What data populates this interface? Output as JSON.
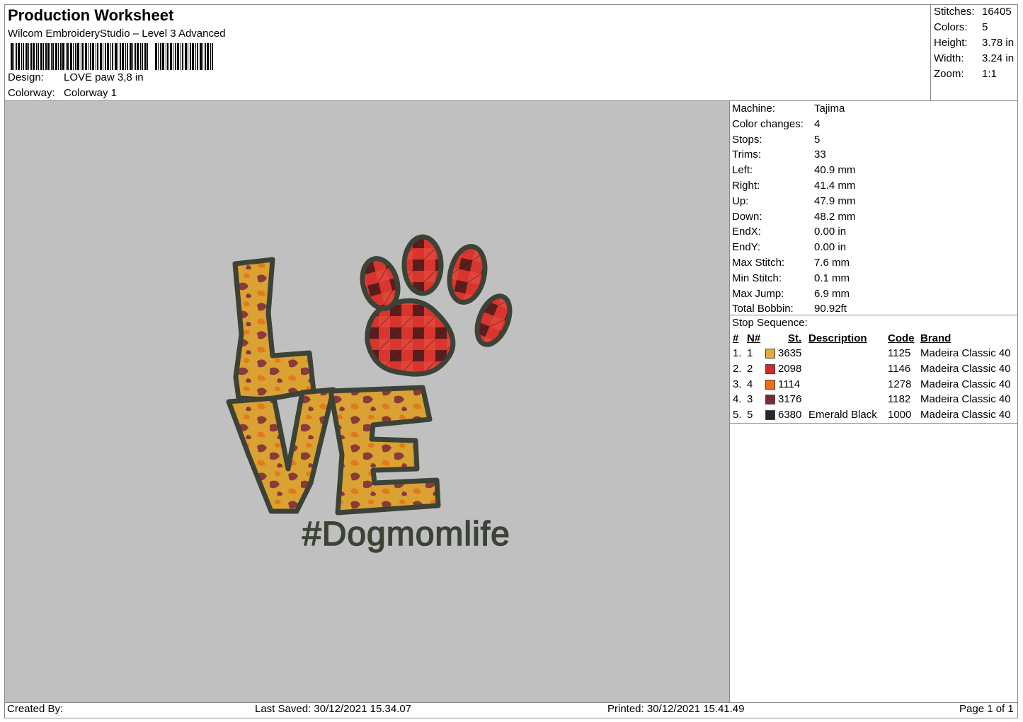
{
  "header": {
    "title": "Production Worksheet",
    "subtitle": "Wilcom EmbroideryStudio – Level 3 Advanced",
    "design_label": "Design:",
    "design_value": "LOVE paw 3,8 in",
    "colorway_label": "Colorway:",
    "colorway_value": "Colorway 1"
  },
  "stats": [
    {
      "label": "Stitches:",
      "value": "16405"
    },
    {
      "label": "Colors:",
      "value": "5"
    },
    {
      "label": "Height:",
      "value": "3.78 in"
    },
    {
      "label": "Width:",
      "value": "3.24 in"
    },
    {
      "label": "Zoom:",
      "value": "1:1"
    }
  ],
  "machine_info": [
    {
      "label": "Machine:",
      "value": "Tajima"
    },
    {
      "label": "Color changes:",
      "value": "4"
    },
    {
      "label": "Stops:",
      "value": "5"
    },
    {
      "label": "Trims:",
      "value": "33"
    },
    {
      "label": "Left:",
      "value": "40.9 mm"
    },
    {
      "label": "Right:",
      "value": "41.4 mm"
    },
    {
      "label": "Up:",
      "value": "47.9 mm"
    },
    {
      "label": "Down:",
      "value": "48.2 mm"
    },
    {
      "label": "EndX:",
      "value": "0.00 in"
    },
    {
      "label": "EndY:",
      "value": "0.00 in"
    },
    {
      "label": "Max Stitch:",
      "value": "7.6 mm"
    },
    {
      "label": "Min Stitch:",
      "value": "0.1 mm"
    },
    {
      "label": "Max Jump:",
      "value": "6.9 mm"
    },
    {
      "label": "Total Bobbin:",
      "value": "90.92ft"
    }
  ],
  "stop_sequence": {
    "title": "Stop Sequence:",
    "headers": {
      "num": "#",
      "n": "N#",
      "st": "St.",
      "description": "Description",
      "code": "Code",
      "brand": "Brand"
    },
    "rows": [
      {
        "num": "1.",
        "n": "1",
        "color": "#e8a83a",
        "st": "3635",
        "description": "",
        "code": "1125",
        "brand": "Madeira Classic 40"
      },
      {
        "num": "2.",
        "n": "2",
        "color": "#d8262b",
        "st": "2098",
        "description": "",
        "code": "1146",
        "brand": "Madeira Classic 40"
      },
      {
        "num": "3.",
        "n": "4",
        "color": "#f26a1b",
        "st": "1114",
        "description": "",
        "code": "1278",
        "brand": "Madeira Classic 40"
      },
      {
        "num": "4.",
        "n": "3",
        "color": "#7a2a34",
        "st": "3176",
        "description": "",
        "code": "1182",
        "brand": "Madeira Classic 40"
      },
      {
        "num": "5.",
        "n": "5",
        "color": "#262626",
        "st": "6380",
        "description": "Emerald Black",
        "code": "1000",
        "brand": "Madeira Classic 40"
      }
    ]
  },
  "design_preview": {
    "text": "#Dogmomlife",
    "colors": {
      "outline": "#3c4236",
      "gold": "#d9a232",
      "orange": "#e07a1c",
      "maroon": "#8a3a3a",
      "red": "#d8352e",
      "darkred": "#5a1e1e"
    }
  },
  "footer": {
    "created_by": "Created By:",
    "last_saved": "Last Saved: 30/12/2021 15.34.07",
    "printed": "Printed: 30/12/2021 15.41.49",
    "page": "Page 1 of 1"
  }
}
